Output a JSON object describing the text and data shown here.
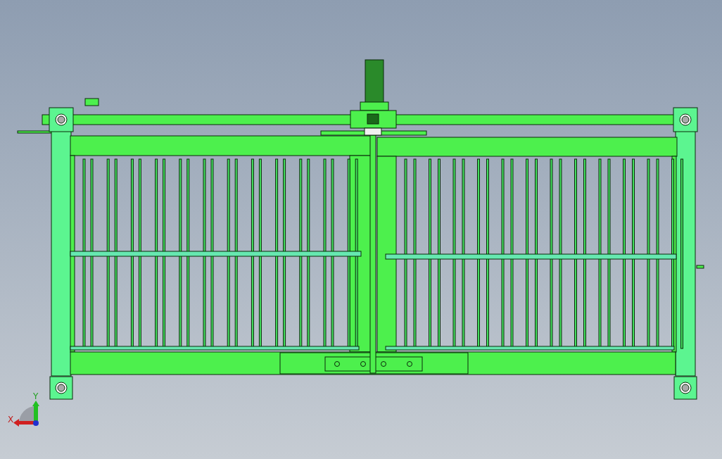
{
  "viewport": {
    "axis_triad": {
      "x_label": "X",
      "y_label": "Y"
    }
  }
}
